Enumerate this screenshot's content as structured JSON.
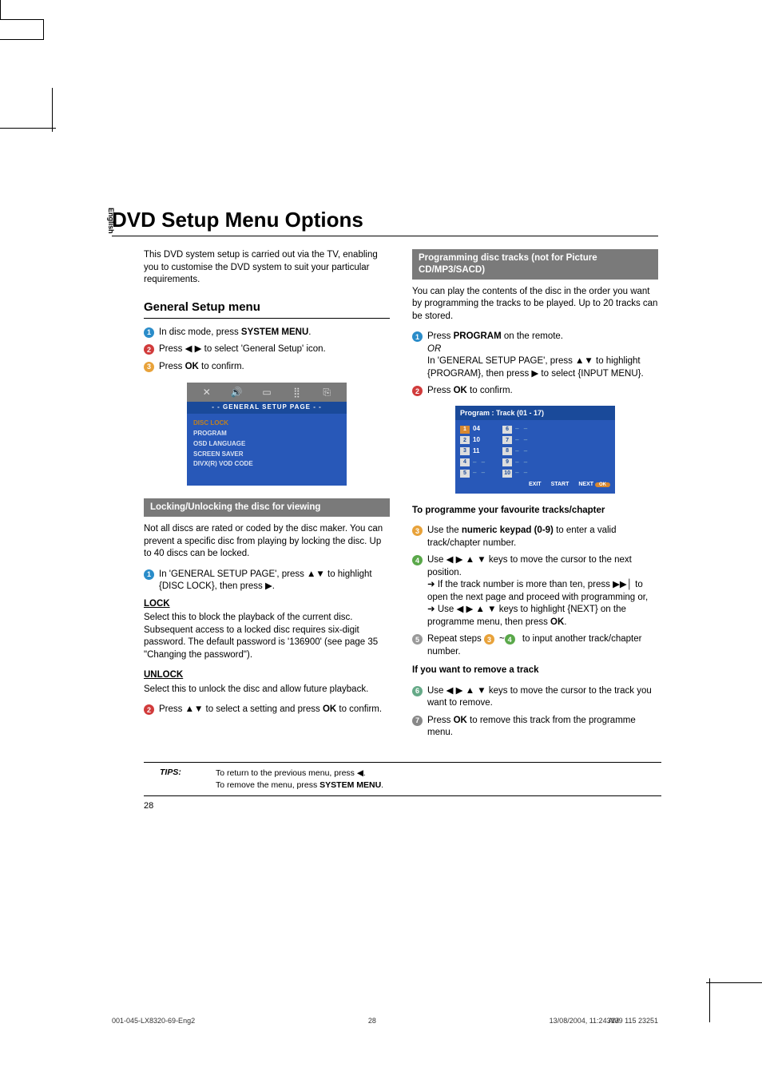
{
  "title": "DVD Setup Menu Options",
  "language_tab": "English",
  "intro": "This DVD system setup is carried out via the TV, enabling you to customise the DVD system to suit your particular requirements.",
  "section_head": "General Setup menu",
  "steps_a": {
    "s1_a": "In disc mode, press ",
    "s1_b": "SYSTEM MENU",
    "s1_c": ".",
    "s2_a": "Press ◀ ▶ to select 'General Setup' icon.",
    "s3_a": "Press ",
    "s3_b": "OK",
    "s3_c": " to confirm."
  },
  "osd": {
    "header": "- -   GENERAL  SETUP  PAGE   - -",
    "items": [
      "DISC LOCK",
      "PROGRAM",
      "OSD LANGUAGE",
      "SCREEN SAVER",
      "DIVX(R) VOD CODE"
    ]
  },
  "lock_section": {
    "subhead": "Locking/Unlocking the disc for viewing",
    "para1": "Not all discs are rated or coded by the disc maker.  You can prevent a specific disc from playing by locking the disc.  Up to 40 discs can be locked.",
    "s1": "In 'GENERAL SETUP PAGE', press ▲▼ to highlight {DISC LOCK}, then press ▶.",
    "lock_t": "LOCK",
    "lock_p": "Select this to block the playback of the current disc.  Subsequent access to a locked disc requires six-digit password. The default password is '136900' (see page 35 \"Changing the password\").",
    "unlock_t": "UNLOCK",
    "unlock_p": "Select this to unlock the disc and allow future playback.",
    "s2_a": "Press ▲▼  to select a setting and press ",
    "s2_b": "OK",
    "s2_c": " to confirm."
  },
  "prog_section": {
    "subhead": "Programming disc tracks (not for Picture CD/MP3/SACD)",
    "para1": "You can play the contents of the disc in the order you want by programming the tracks to be played. Up to 20 tracks can be stored.",
    "s1_a": "Press ",
    "s1_b": "PROGRAM",
    "s1_c": " on the remote.",
    "or": "OR",
    "s1_d": "In 'GENERAL SETUP PAGE', press ▲▼ to highlight {PROGRAM}, then press ▶  to select {INPUT MENU}.",
    "s2_a": "Press ",
    "s2_b": "OK",
    "s2_c": " to confirm.",
    "box_header": "Program : Track (01 - 17)",
    "box_left_nums": [
      "1",
      "2",
      "3",
      "4",
      "5"
    ],
    "box_left_vals": [
      "04",
      "10",
      "11",
      "",
      ""
    ],
    "box_right_nums": [
      "6",
      "7",
      "8",
      "9",
      "10"
    ],
    "box_footer": [
      "EXIT",
      "START",
      "NEXT"
    ],
    "fav_head": "To programme your favourite tracks/chapter",
    "s3_a": "Use the ",
    "s3_b": "numeric keypad (0-9)",
    "s3_c": " to enter a valid track/chapter number.",
    "s4_a": "Use ◀ ▶ ▲ ▼ keys to move the cursor to the next position.",
    "s4_b": "➜ If the track number is more than ten, press ▶▶│  to open the next page and proceed with programming or,",
    "s4_c_a": "➜ Use ◀ ▶ ▲ ▼ keys to highlight {NEXT} on the programme menu, then press ",
    "s4_c_b": "OK",
    "s4_c_c": ".",
    "s5_a": "Repeat steps ",
    "s5_b": "~",
    "s5_c": " to input another track/chapter number.",
    "rem_head": "If you want to remove a track",
    "s6": "Use ◀ ▶ ▲ ▼ keys to move the cursor to the track you want to remove.",
    "s7_a": "Press ",
    "s7_b": "OK",
    "s7_c": " to remove this track from the programme menu."
  },
  "tips": {
    "label": "TIPS:",
    "line1": "To return to the previous menu, press ◀.",
    "line2_a": "To remove the menu, press ",
    "line2_b": "SYSTEM MENU",
    "line2_c": "."
  },
  "pagenum": "28",
  "footer": {
    "left": "001-045-LX8320-69-Eng2",
    "mid": "28",
    "right_a": "13/08/2004, 11:24 AM",
    "right_b": "3139 115 23251"
  }
}
